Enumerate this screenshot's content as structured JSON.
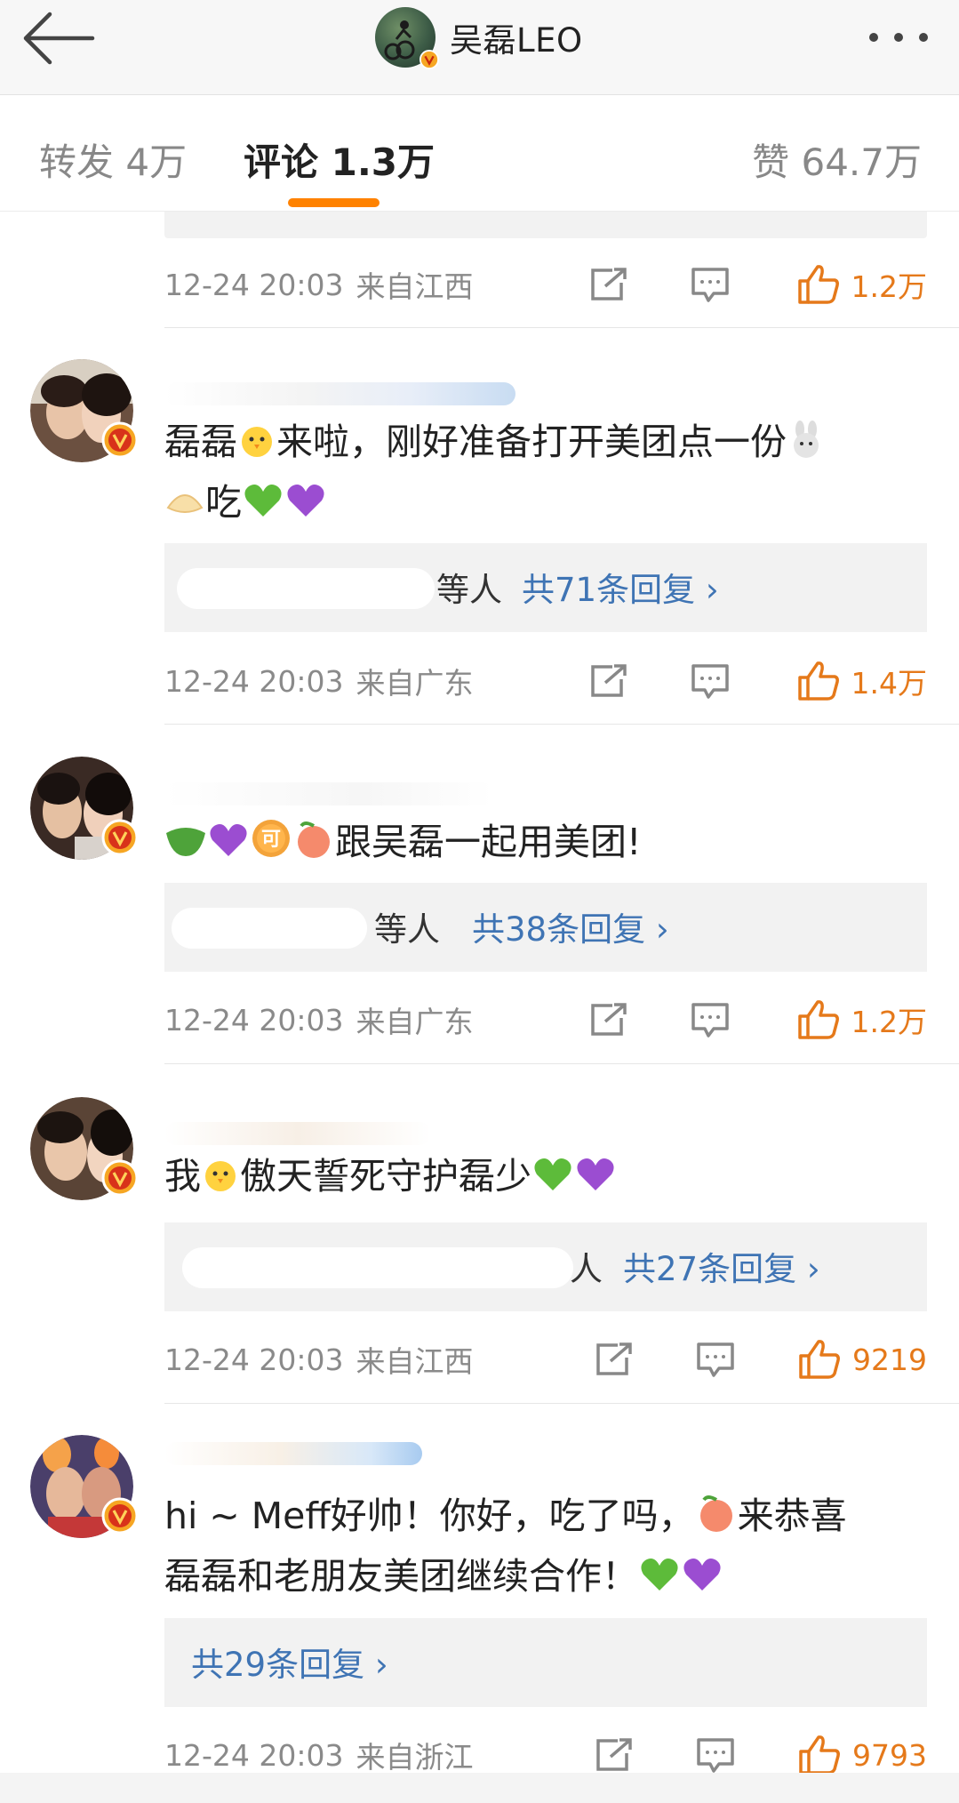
{
  "header": {
    "title": "吴磊LEO",
    "back_icon": "arrow-left-icon",
    "more_icon": "more-horizontal-icon"
  },
  "tabs": [
    {
      "label": "转发 4万",
      "active": false
    },
    {
      "label": "评论 1.3万",
      "active": true
    },
    {
      "label": "赞 64.7万",
      "active": false
    }
  ],
  "accent_color": "#ff8200",
  "link_color": "#3f74b4",
  "comments": [
    {
      "time": "12-24 20:03",
      "location": "来自江西",
      "likes": "1.2万"
    },
    {
      "text_line1": "磊磊",
      "text_line1b": "来啦，刚好准备打开美团点一份",
      "text_line2": "吃",
      "reply_partial": "等人",
      "reply_link": "共71条回复 ›",
      "time": "12-24 20:03",
      "location": "来自广东",
      "likes": "1.4万"
    },
    {
      "text": "跟吴磊一起用美团!",
      "reply_partial": "等人",
      "reply_link": "共38条回复 ›",
      "time": "12-24 20:03",
      "location": "来自广东",
      "likes": "1.2万"
    },
    {
      "text_a": "我",
      "text_b": "傲天誓死守护磊少",
      "reply_partial": "人",
      "reply_link": "共27条回复 ›",
      "time": "12-24 20:03",
      "location": "来自江西",
      "likes": "9219"
    },
    {
      "text_line1": "hi ~ Meff好帅！你好，吃了吗，",
      "text_line1b": "来恭喜",
      "text_line2": "磊磊和老朋友美团继续合作！",
      "reply_link": "共29条回复 ›",
      "time": "12-24 20:03",
      "location": "来自浙江",
      "likes": "9793"
    }
  ]
}
